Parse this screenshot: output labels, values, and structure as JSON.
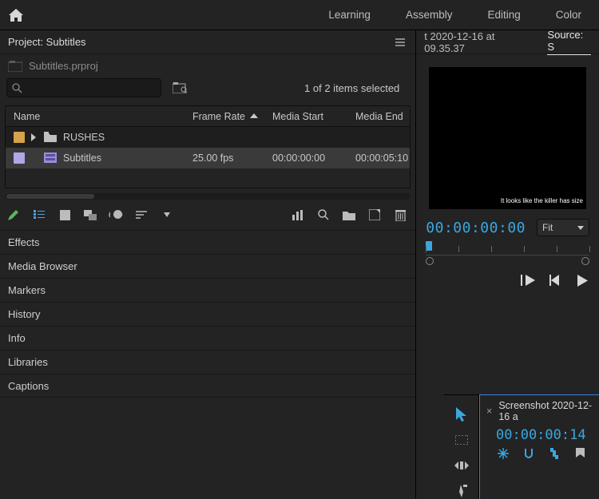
{
  "topbar": {
    "workspaces": [
      "Learning",
      "Assembly",
      "Editing",
      "Color"
    ]
  },
  "project_panel": {
    "title": "Project: Subtitles",
    "file_name": "Subtitles.prproj",
    "selection_text": "1 of 2 items selected",
    "columns": {
      "name": "Name",
      "frame_rate": "Frame Rate",
      "media_start": "Media Start",
      "media_end": "Media End"
    },
    "rows": [
      {
        "name": "RUSHES",
        "type": "bin",
        "frame_rate": "",
        "media_start": "",
        "media_end": "",
        "chip": "orange"
      },
      {
        "name": "Subtitles",
        "type": "sequence",
        "frame_rate": "25.00 fps",
        "media_start": "00:00:00:00",
        "media_end": "00:00:05:10",
        "chip": "lav"
      }
    ]
  },
  "side_panels": [
    "Effects",
    "Media Browser",
    "Markers",
    "History",
    "Info",
    "Libraries",
    "Captions"
  ],
  "source": {
    "tab_clip": "t 2020-12-16 at 09.35.37",
    "tab_source": "Source: S",
    "caption_overlay": "It looks like the killer has size",
    "timecode": "00:00:00:00",
    "fit_label": "Fit"
  },
  "timeline": {
    "tab_label": "Screenshot 2020-12-16 a",
    "timecode": "00:00:00:14"
  }
}
